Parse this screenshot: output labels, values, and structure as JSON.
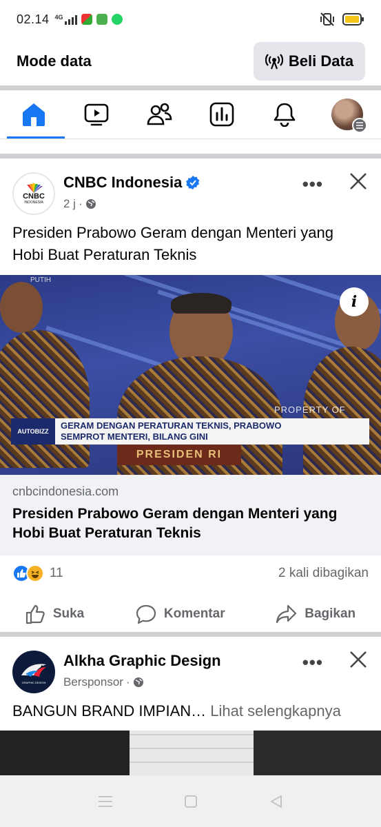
{
  "status_bar": {
    "time": "02.14",
    "network": "4G",
    "battery_color": "#f5c518"
  },
  "mode_bar": {
    "title": "Mode data",
    "buy_button": "Beli Data"
  },
  "nav": {
    "items": [
      "home-icon",
      "video-icon",
      "friends-icon",
      "feeds-icon",
      "bell-icon",
      "profile-avatar"
    ],
    "active": "home",
    "accent": "#1877f2"
  },
  "post1": {
    "page_name": "CNBC Indonesia",
    "verified": true,
    "time": "2 j",
    "text": "Presiden Prabowo Geram dengan Menteri yang Hobi Buat Peraturan Teknis",
    "image": {
      "tag": "AUTOBIZZ",
      "headline_line1": "GERAM DENGAN PERATURAN TEKNIS, PRABOWO",
      "headline_line2": "SEMPROT MENTERI, BILANG GINI",
      "podium": "PRESIDEN RI",
      "property": "PROPERTY OF"
    },
    "link_domain": "cnbcindonesia.com",
    "link_title": "Presiden Prabowo Geram dengan Menteri yang Hobi Buat Peraturan Teknis",
    "reaction_count": "11",
    "shares": "2 kali dibagikan",
    "actions": {
      "like": "Suka",
      "comment": "Komentar",
      "share": "Bagikan"
    }
  },
  "post2": {
    "page_name": "Alkha Graphic Design",
    "meta": "Bersponsor",
    "text": "BANGUN BRAND IMPIAN…",
    "see_more": "Lihat selengkapnya"
  }
}
